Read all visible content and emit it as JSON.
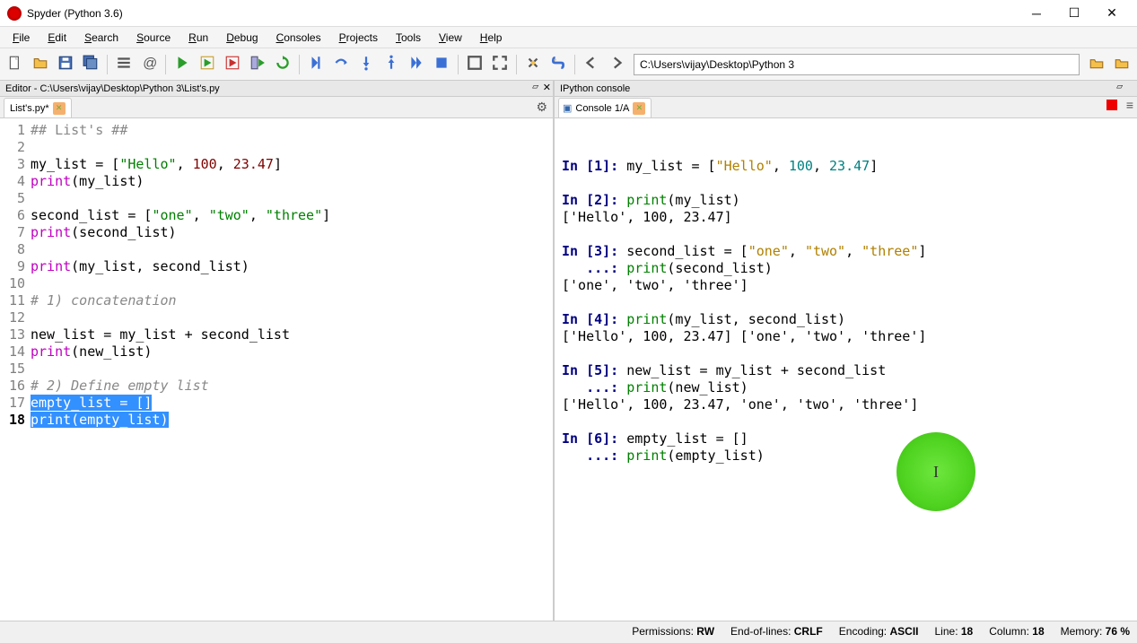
{
  "window": {
    "title": "Spyder (Python 3.6)"
  },
  "menu": [
    "File",
    "Edit",
    "Search",
    "Source",
    "Run",
    "Debug",
    "Consoles",
    "Projects",
    "Tools",
    "View",
    "Help"
  ],
  "path": "C:\\Users\\vijay\\Desktop\\Python 3",
  "editor": {
    "pane_title": "Editor - C:\\Users\\vijay\\Desktop\\Python 3\\List's.py",
    "tab": "List's.py*",
    "current_line": 18,
    "lines": [
      {
        "n": 1,
        "t": "## List's ##",
        "cls": "c-com"
      },
      {
        "n": 2,
        "t": ""
      },
      {
        "n": 3,
        "seg": [
          {
            "t": "my_list = ["
          },
          {
            "t": "\"Hello\"",
            "cls": "c-str"
          },
          {
            "t": ", "
          },
          {
            "t": "100",
            "cls": "c-num"
          },
          {
            "t": ", "
          },
          {
            "t": "23.47",
            "cls": "c-num"
          },
          {
            "t": "]"
          }
        ]
      },
      {
        "n": 4,
        "seg": [
          {
            "t": "print",
            "cls": "c-kw"
          },
          {
            "t": "(my_list)"
          }
        ]
      },
      {
        "n": 5,
        "t": ""
      },
      {
        "n": 6,
        "seg": [
          {
            "t": "second_list = ["
          },
          {
            "t": "\"one\"",
            "cls": "c-str"
          },
          {
            "t": ", "
          },
          {
            "t": "\"two\"",
            "cls": "c-str"
          },
          {
            "t": ", "
          },
          {
            "t": "\"three\"",
            "cls": "c-str"
          },
          {
            "t": "]"
          }
        ]
      },
      {
        "n": 7,
        "seg": [
          {
            "t": "print",
            "cls": "c-kw"
          },
          {
            "t": "(second_list)"
          }
        ]
      },
      {
        "n": 8,
        "t": ""
      },
      {
        "n": 9,
        "seg": [
          {
            "t": "print",
            "cls": "c-kw"
          },
          {
            "t": "(my_list, second_list)"
          }
        ]
      },
      {
        "n": 10,
        "t": ""
      },
      {
        "n": 11,
        "t": "# 1) concatenation",
        "cls": "c-it"
      },
      {
        "n": 12,
        "t": ""
      },
      {
        "n": 13,
        "seg": [
          {
            "t": "new_list = my_list + second_list"
          }
        ]
      },
      {
        "n": 14,
        "seg": [
          {
            "t": "print",
            "cls": "c-kw"
          },
          {
            "t": "(new_list)"
          }
        ]
      },
      {
        "n": 15,
        "t": ""
      },
      {
        "n": 16,
        "t": "# 2) Define empty list",
        "cls": "c-it"
      },
      {
        "n": 17,
        "sel": true,
        "seg": [
          {
            "t": "empty_list = []"
          }
        ]
      },
      {
        "n": 18,
        "sel": true,
        "seg": [
          {
            "t": "print",
            "cls": "c-kw"
          },
          {
            "t": "(empty_list)"
          }
        ]
      }
    ]
  },
  "console": {
    "pane_title": "IPython console",
    "tab": "Console 1/A",
    "cells": [
      {
        "in_n": 1,
        "in": [
          [
            {
              "t": "my_list = ["
            },
            {
              "t": "\"Hello\"",
              "cls": "c-con-str"
            },
            {
              "t": ", "
            },
            {
              "t": "100",
              "cls": "c-con-num"
            },
            {
              "t": ", "
            },
            {
              "t": "23.47",
              "cls": "c-con-num"
            },
            {
              "t": "]"
            }
          ]
        ],
        "out": null
      },
      {
        "in_n": 2,
        "in": [
          [
            {
              "t": "print",
              "cls": "c-con-kw"
            },
            {
              "t": "(my_list)"
            }
          ]
        ],
        "out": "['Hello', 100, 23.47]"
      },
      {
        "in_n": 3,
        "in": [
          [
            {
              "t": "second_list = ["
            },
            {
              "t": "\"one\"",
              "cls": "c-con-str"
            },
            {
              "t": ", "
            },
            {
              "t": "\"two\"",
              "cls": "c-con-str"
            },
            {
              "t": ", "
            },
            {
              "t": "\"three\"",
              "cls": "c-con-str"
            },
            {
              "t": "]"
            }
          ],
          [
            {
              "t": "print",
              "cls": "c-con-kw"
            },
            {
              "t": "(second_list)"
            }
          ]
        ],
        "out": "['one', 'two', 'three']"
      },
      {
        "in_n": 4,
        "in": [
          [
            {
              "t": "print",
              "cls": "c-con-kw"
            },
            {
              "t": "(my_list, second_list)"
            }
          ]
        ],
        "out": "['Hello', 100, 23.47] ['one', 'two', 'three']"
      },
      {
        "in_n": 5,
        "in": [
          [
            {
              "t": "new_list = my_list + second_list"
            }
          ],
          [
            {
              "t": "print",
              "cls": "c-con-kw"
            },
            {
              "t": "(new_list)"
            }
          ]
        ],
        "out": "['Hello', 100, 23.47, 'one', 'two', 'three']"
      },
      {
        "in_n": 6,
        "in": [
          [
            {
              "t": "empty_list = []"
            }
          ],
          [
            {
              "t": "print",
              "cls": "c-con-kw"
            },
            {
              "t": "(empty_list)"
            }
          ]
        ],
        "out": null
      }
    ]
  },
  "status": {
    "perm_label": "Permissions:",
    "perm": "RW",
    "eol_label": "End-of-lines:",
    "eol": "CRLF",
    "enc_label": "Encoding:",
    "enc": "ASCII",
    "line_label": "Line:",
    "line": "18",
    "col_label": "Column:",
    "col": "18",
    "mem_label": "Memory:",
    "mem": "76 %"
  },
  "toolbar_icons": [
    "new-file",
    "open-file",
    "save-file",
    "save-all",
    "sep",
    "outline",
    "at-symbol",
    "sep",
    "run",
    "run-cell",
    "run-cell-advance",
    "run-selection",
    "rerun",
    "sep",
    "debug",
    "step-over",
    "step-in",
    "step-out",
    "continue",
    "stop",
    "sep",
    "maximize",
    "fullscreen",
    "sep",
    "preferences",
    "python-path",
    "sep",
    "back",
    "forward"
  ]
}
